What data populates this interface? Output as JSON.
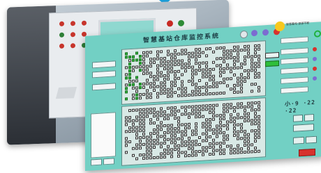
{
  "window": {
    "title": "智慧基站仓库监控系统",
    "logo_text": "智慧蓄电·源源不断"
  },
  "big_numbers": "小·9 ·22 ·22",
  "colors": {
    "photo_bg": "#9ca9b4",
    "window_bg": "#72d0c4",
    "cell_on": "#2ebf3a",
    "cell_off": "#f6f6f6",
    "accent_red": "#d7322e",
    "accent_green": "#1fb13d"
  },
  "icons": [
    "chevron-down-icon",
    "gear-icon",
    "close-icon",
    "status-icon",
    "logo-icon"
  ]
}
